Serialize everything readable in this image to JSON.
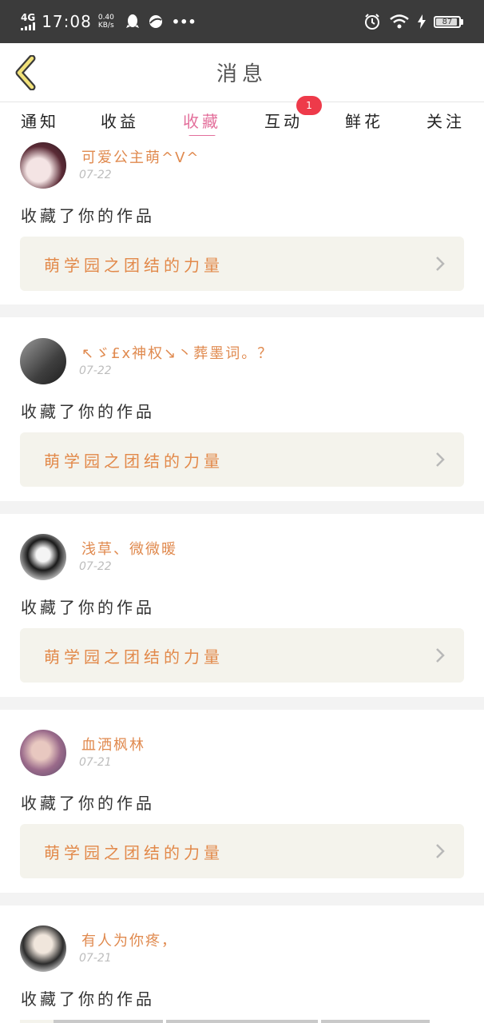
{
  "status_bar": {
    "network": "4G",
    "time": "17:08",
    "speed_value": "0.40",
    "speed_unit": "KB/s",
    "more": "•••",
    "battery": "87"
  },
  "header": {
    "title": "消息",
    "back_icon": "chevron-left-icon"
  },
  "tabs": [
    {
      "label": "通知"
    },
    {
      "label": "收益"
    },
    {
      "label": "收藏",
      "active": true
    },
    {
      "label": "互动",
      "badge": "1"
    },
    {
      "label": "鲜花"
    },
    {
      "label": "关注"
    }
  ],
  "messages": [
    {
      "username": "可爱公主萌^V^",
      "date": "07-22",
      "action": "收藏了你的作品",
      "work": "萌学园之团结的力量"
    },
    {
      "username": "↖ゞ£х神权↘丶葬墨词。？",
      "date": "07-22",
      "action": "收藏了你的作品",
      "work": "萌学园之团结的力量"
    },
    {
      "username": "浅草、微微暖",
      "date": "07-22",
      "action": "收藏了你的作品",
      "work": "萌学园之团结的力量"
    },
    {
      "username": "血洒枫林",
      "date": "07-21",
      "action": "收藏了你的作品",
      "work": "萌学园之团结的力量"
    },
    {
      "username": "有人为你疼，",
      "date": "07-21",
      "action": "收藏了你的作品",
      "work": ""
    }
  ],
  "colors": {
    "accent": "#e36f9b",
    "username": "#e08a4f",
    "badge": "#ee3a4a",
    "link_bg": "#f4f3ec"
  }
}
